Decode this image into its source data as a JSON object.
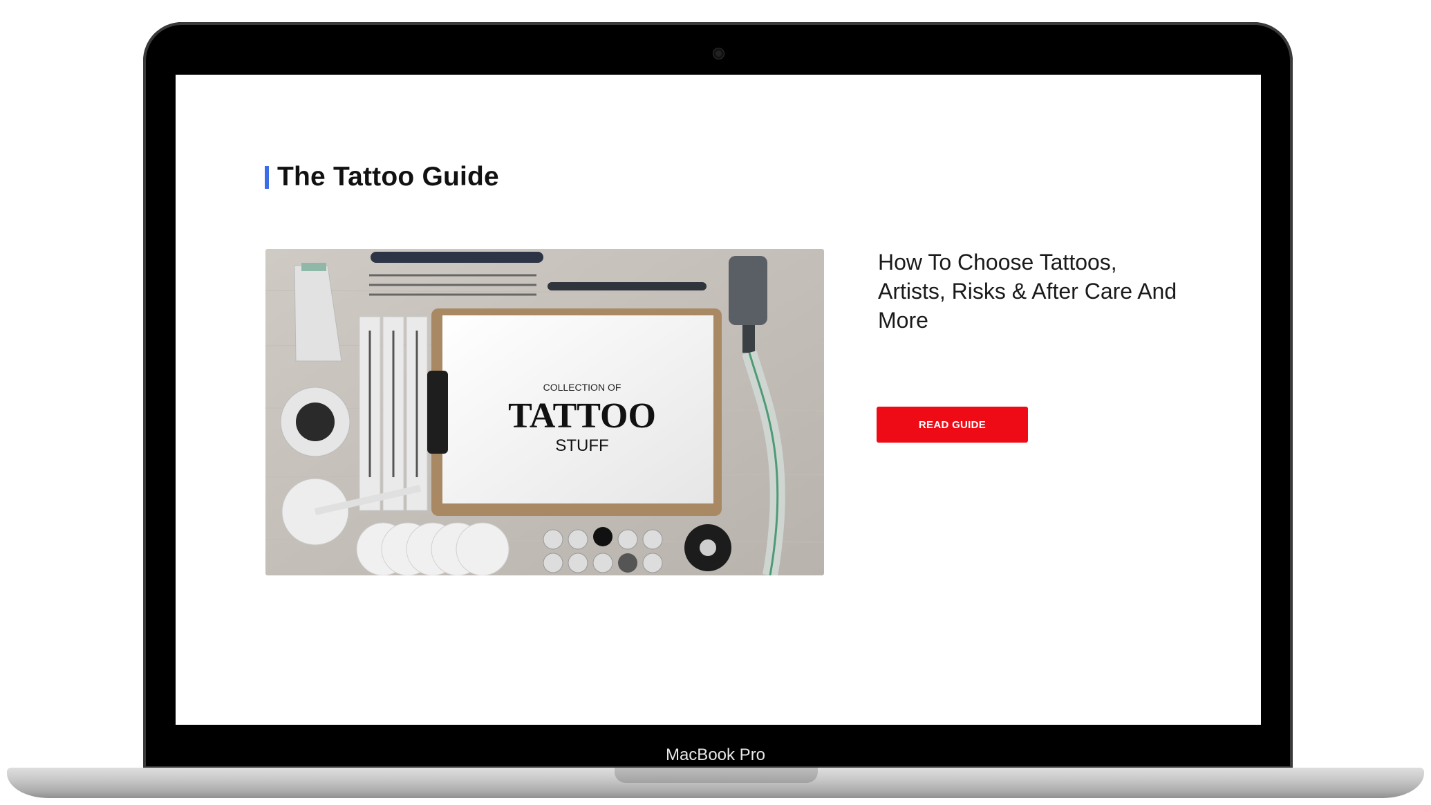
{
  "device": {
    "model_label": "MacBook Pro"
  },
  "page": {
    "section_title": "The Tattoo Guide",
    "accent_color": "#3b6de8",
    "guide": {
      "title": "How To Choose Tattoos, Artists, Risks & After Care And More",
      "button_label": "READ GUIDE",
      "button_color": "#ee0b16"
    },
    "hero_image": {
      "caption_top": "COLLECTION OF",
      "caption_main": "TATTOO",
      "caption_bottom": "STUFF"
    }
  }
}
